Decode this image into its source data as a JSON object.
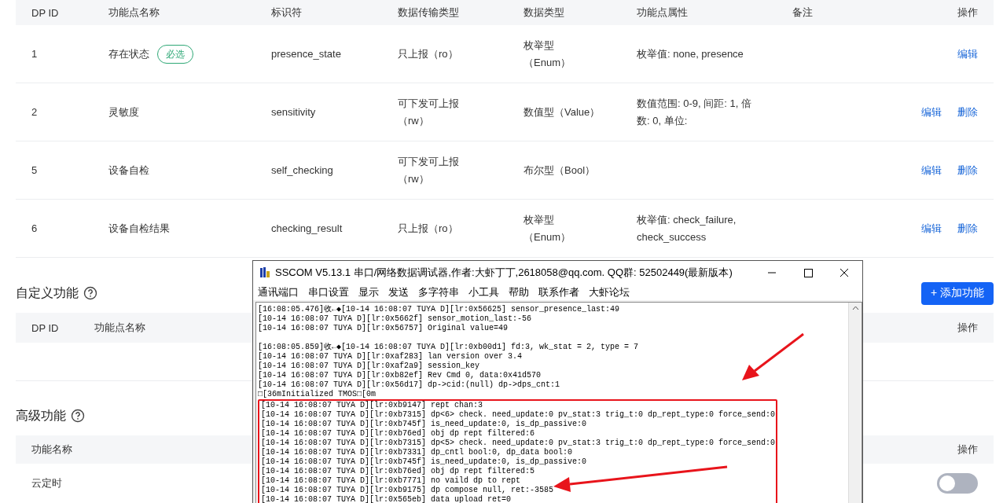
{
  "main_table": {
    "columns": [
      "DP ID",
      "功能点名称",
      "标识符",
      "数据传输类型",
      "数据类型",
      "功能点属性",
      "备注",
      "操作"
    ],
    "rows": [
      {
        "dp_id": "1",
        "name": "存在状态",
        "badge": "必选",
        "identifier": "presence_state",
        "transfer": [
          "只上报（ro）"
        ],
        "data_type": [
          "枚举型",
          "（Enum）"
        ],
        "properties": [
          "枚举值: none, presence"
        ],
        "actions": [
          "编辑"
        ]
      },
      {
        "dp_id": "2",
        "name": "灵敏度",
        "identifier": "sensitivity",
        "transfer": [
          "可下发可上报",
          "（rw）"
        ],
        "data_type": [
          "数值型（Value）"
        ],
        "properties": [
          "数值范围: 0-9, 间距: 1, 倍",
          "数: 0, 单位:"
        ],
        "actions": [
          "编辑",
          "删除"
        ]
      },
      {
        "dp_id": "5",
        "name": "设备自检",
        "identifier": "self_checking",
        "transfer": [
          "可下发可上报",
          "（rw）"
        ],
        "data_type": [
          "布尔型（Bool）"
        ],
        "properties": [],
        "actions": [
          "编辑",
          "删除"
        ]
      },
      {
        "dp_id": "6",
        "name": "设备自检结果",
        "identifier": "checking_result",
        "transfer": [
          "只上报（ro）"
        ],
        "data_type": [
          "枚举型",
          "（Enum）"
        ],
        "properties": [
          "枚举值: check_failure,",
          "check_success"
        ],
        "actions": [
          "编辑",
          "删除"
        ]
      }
    ]
  },
  "custom_section": {
    "title": "自定义功能",
    "add_button": "+ 添加功能",
    "columns": [
      "DP ID",
      "功能点名称",
      "操作"
    ]
  },
  "advanced_section": {
    "title": "高级功能",
    "columns": [
      "功能名称",
      "操作"
    ],
    "rows": [
      {
        "name": "云定时",
        "on": false
      }
    ]
  },
  "sscom_window": {
    "title": "SSCOM V5.13.1 串口/网络数据调试器,作者:大虾丁丁,2618058@qq.com. QQ群:  52502449(最新版本)",
    "menu": [
      "通讯端口",
      "串口设置",
      "显示",
      "发送",
      "多字符串",
      "小工具",
      "帮助",
      "联系作者",
      "大虾论坛"
    ],
    "log_blocks": [
      [
        "[16:08:05.476]收←◆[10-14 16:08:07 TUYA D][lr:0x56625] sensor_presence_last:49",
        "[10-14 16:08:07 TUYA D][lr:0x5662f] sensor_motion_last:-56",
        "[10-14 16:08:07 TUYA D][lr:0x56757] Original value=49"
      ],
      [
        "[16:08:05.859]收←◆[10-14 16:08:07 TUYA D][lr:0xb00d1] fd:3, wk_stat = 2, type = 7",
        "[10-14 16:08:07 TUYA D][lr:0xaf283] lan version over 3.4",
        "[10-14 16:08:07 TUYA D][lr:0xaf2a9] session_key",
        "[10-14 16:08:07 TUYA D][lr:0xb82ef] Rev Cmd 0, data:0x41d570",
        "[10-14 16:08:07 TUYA D][lr:0x56d17] dp->cid:(null) dp->dps_cnt:1",
        "□[36mInitialized TMOS□[0m"
      ]
    ],
    "highlighted_lines": [
      "[10-14 16:08:07 TUYA D][lr:0xb9147] rept chan:3",
      "[10-14 16:08:07 TUYA D][lr:0xb7315] dp<6> check. need_update:0 pv_stat:3 trig_t:0 dp_rept_type:0 force_send:0",
      "[10-14 16:08:07 TUYA D][lr:0xb745f] is_need_update:0, is_dp_passive:0",
      "[10-14 16:08:07 TUYA D][lr:0xb76ed] obj dp rept filtered:6",
      "[10-14 16:08:07 TUYA D][lr:0xb7315] dp<5> check. need_update:0 pv_stat:3 trig_t:0 dp_rept_type:0 force_send:0",
      "[10-14 16:08:07 TUYA D][lr:0xb7331] dp_cntl bool:0, dp_data bool:0",
      "[10-14 16:08:07 TUYA D][lr:0xb745f] is_need_update:0, is_dp_passive:0",
      "[10-14 16:08:07 TUYA D][lr:0xb76ed] obj dp rept filtered:5",
      "[10-14 16:08:07 TUYA D][lr:0xb7771] no vaild dp to rept",
      "[10-14 16:08:07 TUYA D][lr:0xb9175] dp compose null, ret:-3585",
      "[10-14 16:08:07 TUYA D][lr:0x565eb] data upload ret=0"
    ]
  }
}
